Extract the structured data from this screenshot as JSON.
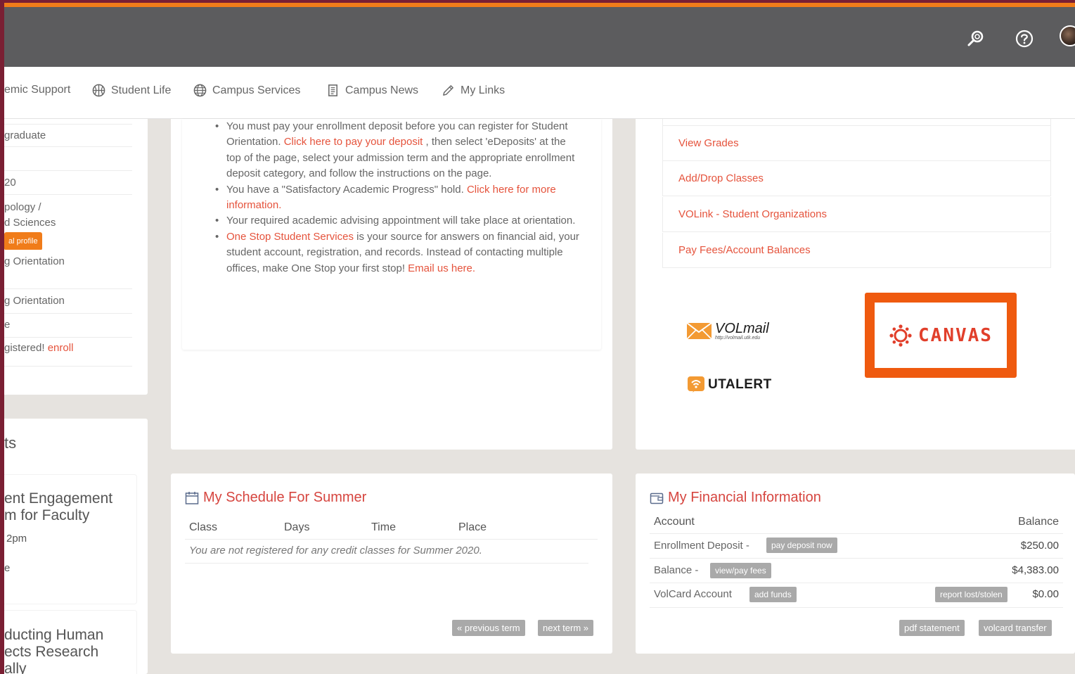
{
  "header": {
    "icons": [
      "search-icon",
      "help-icon",
      "avatar"
    ]
  },
  "nav": {
    "items": [
      {
        "label": "emic Support",
        "icon": "none"
      },
      {
        "label": "Student Life",
        "icon": "basketball-icon"
      },
      {
        "label": "Campus Services",
        "icon": "globe-icon"
      },
      {
        "label": "Campus News",
        "icon": "document-icon"
      },
      {
        "label": "My Links",
        "icon": "pencil-icon"
      }
    ]
  },
  "sidebar": {
    "rows": [
      "graduate",
      "20",
      "pology /",
      "d Sciences",
      "g Orientation",
      "g Orientation",
      "e",
      "gistered!"
    ],
    "profile_badge": "al profile",
    "enroll_link": "enroll",
    "events_title": "ts",
    "event1_title_line1": "ent Engagement",
    "event1_title_line2": "m for Faculty",
    "event1_time": "2pm",
    "event1_extra": "e",
    "event2_title_line1": "ducting Human",
    "event2_title_line2": "ects Research",
    "event2_title_line3": "ally"
  },
  "notices": {
    "n1_text_a": "You must pay your enrollment deposit before you can register for Student Orientation. ",
    "n1_link": "Click here to pay your deposit",
    "n1_text_b": " , then select 'eDeposits' at the top of the page, select your admission term and the appropriate enrollment deposit category, and follow the instructions on the page.",
    "n2_text": "You have a \"Satisfactory Academic Progress\" hold. ",
    "n2_link": "Click here for more information.",
    "n3_text": "Your required academic advising appointment will take place at orientation.",
    "n4_link1": "One Stop Student Services",
    "n4_text": " is your source for answers on financial aid, your student account, registration, and records. Instead of contacting multiple offices, make One Stop your first stop! ",
    "n4_link2": "Email us here."
  },
  "quick_links": [
    "View Grades",
    "Add/Drop Classes",
    "VOLink - Student Organizations",
    "Pay Fees/Account Balances"
  ],
  "apps": {
    "volmail_text": "VOLmail",
    "volmail_url": "http://volmail.utk.edu",
    "utalert": "UTALERT",
    "canvas": "CANVAS",
    "highlight_color": "#ef5a0f"
  },
  "schedule": {
    "title": "My Schedule For Summer",
    "columns": [
      "Class",
      "Days",
      "Time",
      "Place"
    ],
    "empty_message": "You are not registered for any credit classes for Summer 2020.",
    "prev_button": "« previous term",
    "next_button": "next term »"
  },
  "financial": {
    "title": "My Financial Information",
    "col_account": "Account",
    "col_balance": "Balance",
    "rows": [
      {
        "label": "Enrollment Deposit -",
        "button": "pay deposit now",
        "amount": "$250.00"
      },
      {
        "label": "Balance -",
        "button": "view/pay fees",
        "amount": "$4,383.00"
      },
      {
        "label": "VolCard Account",
        "button": "add funds",
        "extra_button": "report lost/stolen",
        "amount": "$0.00"
      }
    ],
    "pdf_button": "pdf statement",
    "volcard_button": "volcard transfer"
  }
}
